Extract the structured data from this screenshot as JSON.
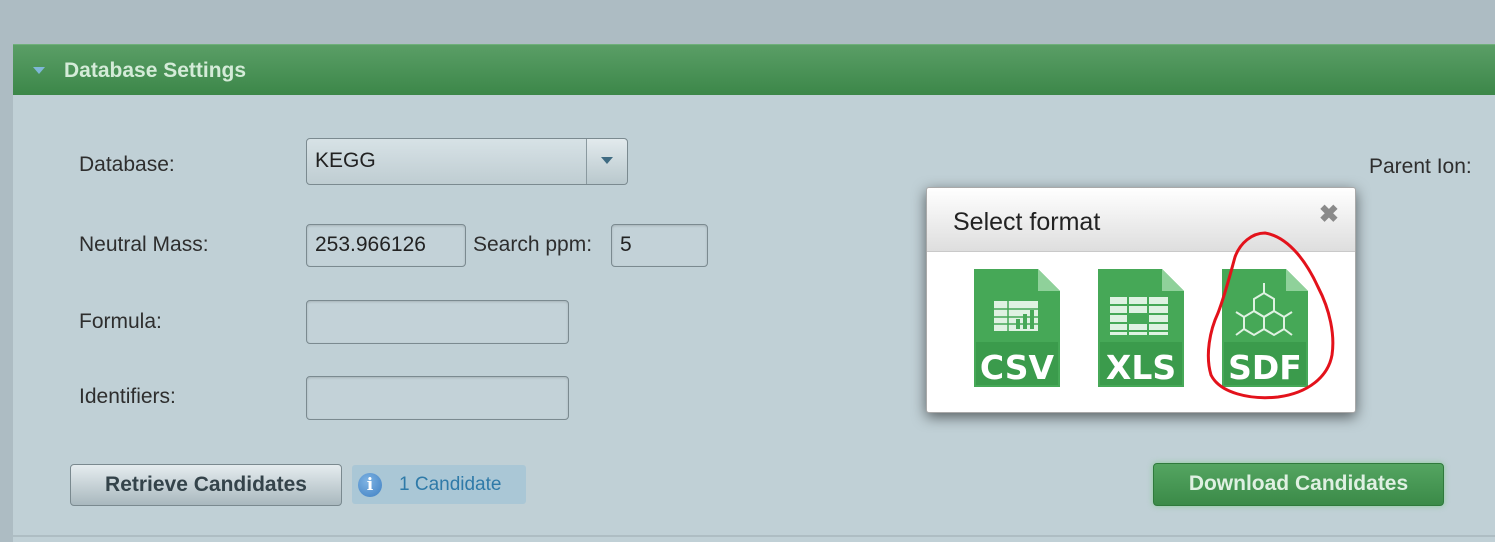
{
  "panel": {
    "title": "Database Settings",
    "database_label": "Database:",
    "database_value": "KEGG",
    "neutral_mass_label": "Neutral Mass:",
    "neutral_mass_value": "253.966126",
    "search_ppm_label": "Search ppm:",
    "search_ppm_value": "5",
    "formula_label": "Formula:",
    "formula_value": "",
    "identifiers_label": "Identifiers:",
    "identifiers_value": "",
    "parent_ion_label": "Parent Ion:",
    "retrieve_button": "Retrieve Candidates",
    "candidate_count": "1 Candidate",
    "info_glyph": "i",
    "download_button": "Download Candidates"
  },
  "dialog": {
    "title": "Select format",
    "close_glyph": "✖",
    "formats": [
      {
        "label": "CSV",
        "icon": "csv-file-icon"
      },
      {
        "label": "XLS",
        "icon": "xls-file-icon"
      },
      {
        "label": "SDF",
        "icon": "sdf-file-icon"
      }
    ]
  },
  "colors": {
    "header_green": "#3c8749",
    "file_icon_green": "#46a857",
    "annotation_red": "#e3121b",
    "info_blue": "#2f7aa8"
  }
}
